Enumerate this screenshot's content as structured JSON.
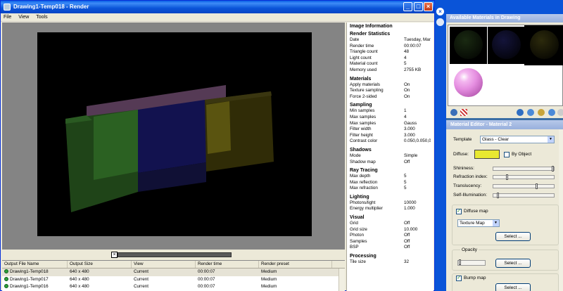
{
  "window": {
    "title": "Drawing1-Temp018 - Render",
    "menu": [
      "File",
      "View",
      "Tools"
    ],
    "controls": [
      "_",
      "□",
      "×"
    ]
  },
  "info_panel": {
    "heading": "Image Information",
    "sections": [
      {
        "title": "Render Statistics",
        "rows": [
          {
            "k": "Date",
            "v": "Tuesday, Marc"
          },
          {
            "k": "Render time",
            "v": "00:00:07"
          },
          {
            "k": "Triangle count",
            "v": "48"
          },
          {
            "k": "Light count",
            "v": "4"
          },
          {
            "k": "Material count",
            "v": "5"
          },
          {
            "k": "Memory used",
            "v": "2755 KB"
          }
        ]
      },
      {
        "title": "Materials",
        "rows": [
          {
            "k": "Apply materials",
            "v": "On"
          },
          {
            "k": "Texture sampling",
            "v": "On"
          },
          {
            "k": "Force 2-sided",
            "v": "On"
          }
        ]
      },
      {
        "title": "Sampling",
        "rows": [
          {
            "k": "Min samples",
            "v": "1"
          },
          {
            "k": "Max samples",
            "v": "4"
          },
          {
            "k": "Max samples",
            "v": "Gauss"
          },
          {
            "k": "Filter width",
            "v": "3.000"
          },
          {
            "k": "Filter height",
            "v": "3.000"
          },
          {
            "k": "Contrast color",
            "v": "0.050,0.050,0"
          }
        ]
      },
      {
        "title": "Shadows",
        "rows": [
          {
            "k": "Mode",
            "v": "Simple"
          },
          {
            "k": "Shadow map",
            "v": "Off"
          }
        ]
      },
      {
        "title": "Ray Tracing",
        "rows": [
          {
            "k": "Max depth",
            "v": "5"
          },
          {
            "k": "Max reflection",
            "v": "5"
          },
          {
            "k": "Max refraction",
            "v": "5"
          }
        ]
      },
      {
        "title": "Lighting",
        "rows": [
          {
            "k": "Photons/light",
            "v": "10000"
          },
          {
            "k": "Energy multiplier",
            "v": "1.000"
          }
        ]
      },
      {
        "title": "Visual",
        "rows": [
          {
            "k": "Grid",
            "v": "Off"
          },
          {
            "k": "Grid size",
            "v": "10.000"
          },
          {
            "k": "Photon",
            "v": "Off"
          },
          {
            "k": "Samples",
            "v": "Off"
          },
          {
            "k": "BSP",
            "v": "Off"
          }
        ]
      },
      {
        "title": "Processing",
        "rows": [
          {
            "k": "Tile size",
            "v": "32"
          }
        ]
      }
    ]
  },
  "output": {
    "splitter_close": "×",
    "columns": [
      "Output File Name",
      "Output Size",
      "View",
      "Render time",
      "Render preset"
    ],
    "rows": [
      [
        "Drawing1-Temp018",
        "640 x 480",
        "Current",
        "00:00:07",
        "Medium"
      ],
      [
        "Drawing1-Temp017",
        "640 x 480",
        "Current",
        "00:00:07",
        "Medium"
      ],
      [
        "Drawing1-Temp016",
        "640 x 480",
        "Current",
        "00:00:07",
        "Medium"
      ]
    ]
  },
  "materials_palette": {
    "title": "Available Materials in Drawing",
    "close_glyph": "×",
    "swatches": [
      {
        "color": "#1a2a12",
        "selected": false
      },
      {
        "color": "#14143a",
        "selected": false
      },
      {
        "color": "#2c2a0c",
        "selected": true
      },
      {
        "color": "#e58ee0",
        "selected": false
      }
    ]
  },
  "material_editor": {
    "title": "Material Editor - Material 2",
    "template_label": "Template",
    "template_value": "Glass - Clear",
    "diffuse_label": "Diffuse:",
    "diffuse_color": "#e8e831",
    "by_object_label": "By Object",
    "sliders": [
      {
        "label": "Shininess:",
        "value": 1.0
      },
      {
        "label": "Refraction index:",
        "value": 0.22
      },
      {
        "label": "Translucency:",
        "value": 0.72
      },
      {
        "label": "Self-Illumination:",
        "value": 0.06
      }
    ],
    "diffuse_map_label": "Diffuse map",
    "diffuse_map_checked": "✓",
    "texture_map_value": "Texture Map",
    "select_label": "Select ...",
    "opacity_label": "Opacity",
    "bump_map_label": "Bump map",
    "bump_map_checked": "✓"
  }
}
